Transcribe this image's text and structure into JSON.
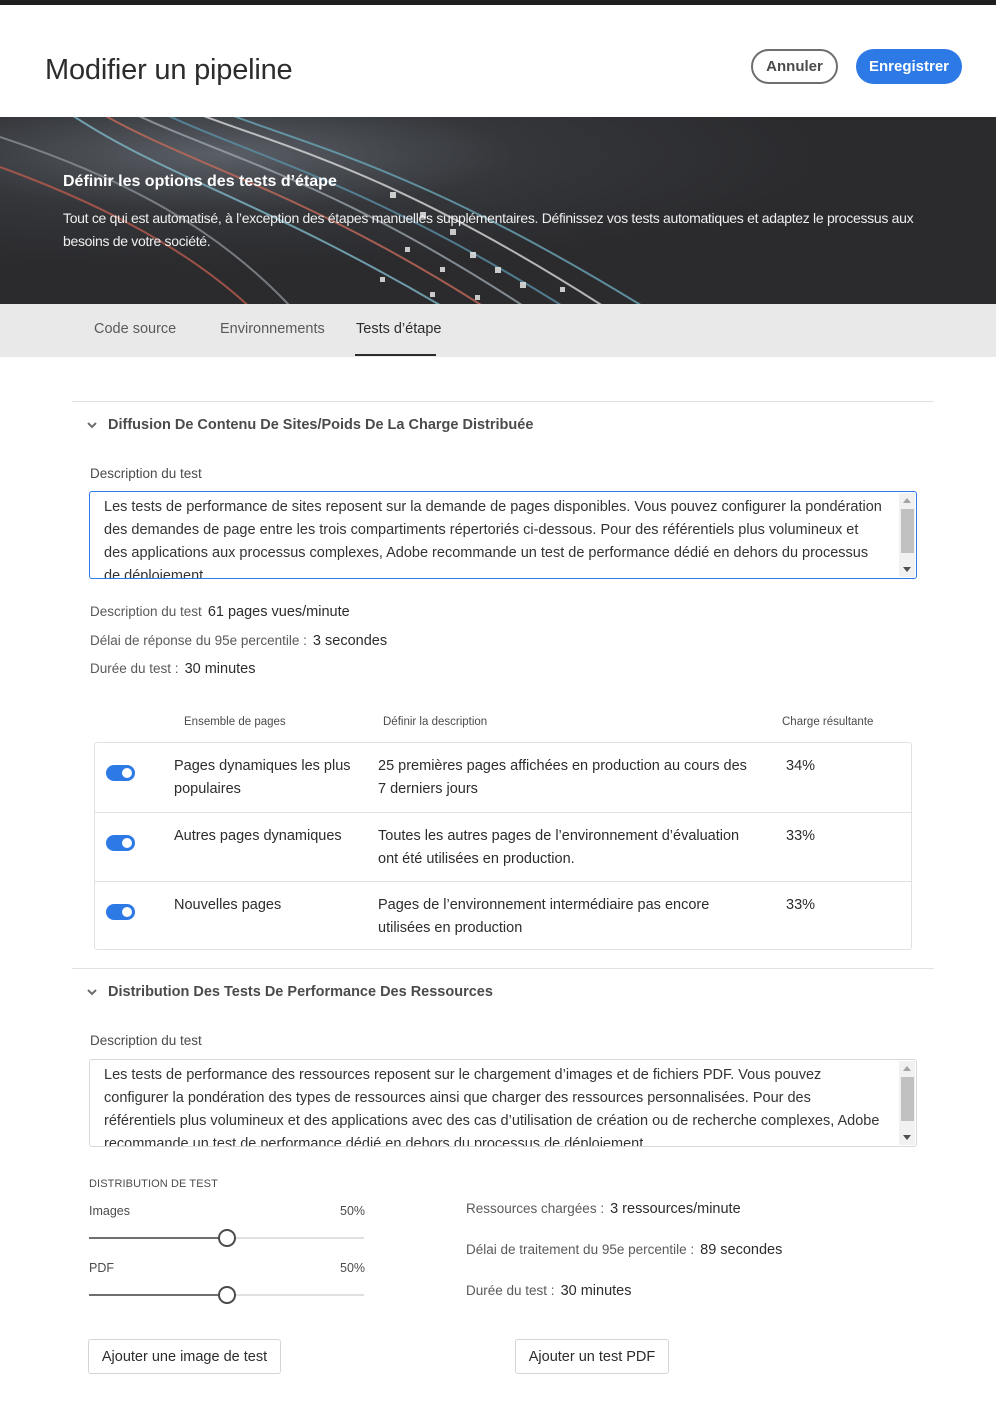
{
  "header": {
    "title": "Modifier un pipeline",
    "cancel_label": "Annuler",
    "save_label": "Enregistrer"
  },
  "hero": {
    "title": "Définir les options des tests d’étape",
    "text": "Tout ce qui est automatisé, à l’exception des étapes manuelles supplémentaires. Définissez vos tests automatiques et adaptez le processus aux besoins de votre société."
  },
  "tabs": [
    {
      "label": "Code source",
      "active": false
    },
    {
      "label": "Environnements",
      "active": false
    },
    {
      "label": "Tests d’étape",
      "active": true
    }
  ],
  "section1": {
    "title": "Diffusion De Contenu De Sites/Poids De La Charge Distribuée",
    "desc_label": "Description du test",
    "desc_text": "Les tests de performance de sites reposent sur la demande de pages disponibles. Vous pouvez configurer la pondération des demandes de page entre les trois compartiments répertoriés ci-dessous. Pour des référentiels plus volumineux et des applications aux processus complexes, Adobe recommande un test de performance dédié en dehors du processus de déploiement.",
    "stats": [
      {
        "label": "Description du test",
        "value": "61 pages vues/minute"
      },
      {
        "label": "Délai de réponse du 95e percentile :",
        "value": "3 secondes"
      },
      {
        "label": "Durée du test :",
        "value": "30 minutes"
      }
    ],
    "columns": [
      "Ensemble de pages",
      "Définir la description",
      "Charge résultante"
    ],
    "rows": [
      {
        "enabled": true,
        "name": "Pages dynamiques les plus populaires",
        "description": "25 premières pages affichées en production au cours des 7 derniers jours",
        "load": "34%"
      },
      {
        "enabled": true,
        "name": "Autres pages dynamiques",
        "description": "Toutes les autres pages de l’environnement d’évaluation ont été utilisées en production.",
        "load": "33%"
      },
      {
        "enabled": true,
        "name": "Nouvelles pages",
        "description": "Pages de l’environnement intermédiaire pas encore utilisées en production",
        "load": "33%"
      }
    ]
  },
  "section2": {
    "title": "Distribution Des Tests De Performance Des Ressources",
    "desc_label": "Description du test",
    "desc_text": "Les tests de performance des ressources reposent sur le chargement d’images et de fichiers PDF. Vous pouvez configurer la pondération des types de ressources ainsi que charger des ressources personnalisées. Pour des référentiels plus volumineux et des applications avec des cas d’utilisation de création ou de recherche complexes, Adobe recommande un test de performance dédié en dehors du processus de déploiement.",
    "distribution_label": "DISTRIBUTION DE TEST",
    "sliders": [
      {
        "label": "Images",
        "value_text": "50%",
        "value": 0.5
      },
      {
        "label": "PDF",
        "value_text": "50%",
        "value": 0.5
      }
    ],
    "stats": [
      {
        "label": "Ressources chargées :",
        "value": "3 ressources/minute"
      },
      {
        "label": "Délai de traitement du 95e percentile :",
        "value": "89 secondes"
      },
      {
        "label": "Durée du test :",
        "value": "30 minutes"
      }
    ],
    "add_image_label": "Ajouter une image de test",
    "add_pdf_label": "Ajouter un test PDF"
  },
  "colors": {
    "accent": "#2d7ae6",
    "hero_bg": "#2b2b2e",
    "tabbar_bg": "#e9e9e9"
  }
}
